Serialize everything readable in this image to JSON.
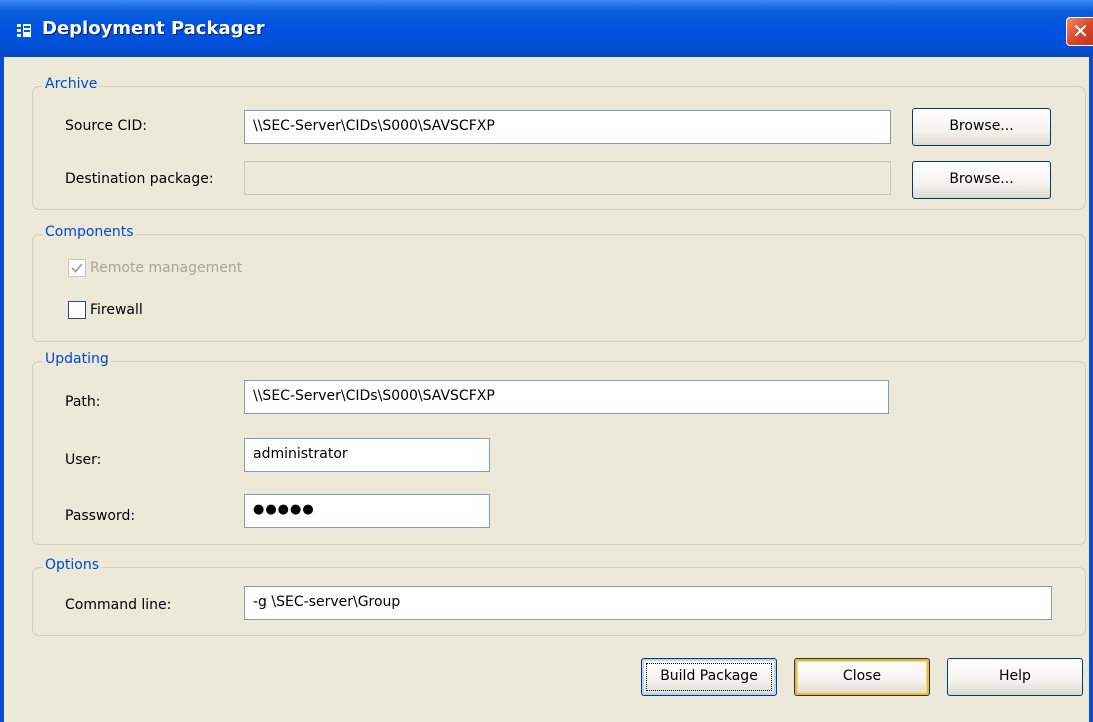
{
  "window": {
    "title": "Deployment Packager",
    "close_glyph": "✕"
  },
  "archive": {
    "legend": "Archive",
    "source_label": "Source CID:",
    "source_value": "\\\\SEC-Server\\CIDs\\S000\\SAVSCFXP",
    "source_browse": "Browse...",
    "dest_label": "Destination package:",
    "dest_value": "",
    "dest_browse": "Browse..."
  },
  "components": {
    "legend": "Components",
    "remote_label": "Remote management",
    "remote_checked": true,
    "remote_disabled": true,
    "firewall_label": "Firewall",
    "firewall_checked": false
  },
  "updating": {
    "legend": "Updating",
    "path_label": "Path:",
    "path_value": "\\\\SEC-Server\\CIDs\\S000\\SAVSCFXP",
    "user_label": "User:",
    "user_value": "administrator",
    "password_label": "Password:",
    "password_value": "●●●●●"
  },
  "options": {
    "legend": "Options",
    "cmd_label": "Command line:",
    "cmd_value": "-g \\SEC-server\\Group"
  },
  "buttons": {
    "build": "Build Package",
    "close": "Close",
    "help": "Help"
  },
  "colors": {
    "title_bar": "#0054e3",
    "legend_text": "#0046d5",
    "dialog_bg": "#ece9d8"
  }
}
